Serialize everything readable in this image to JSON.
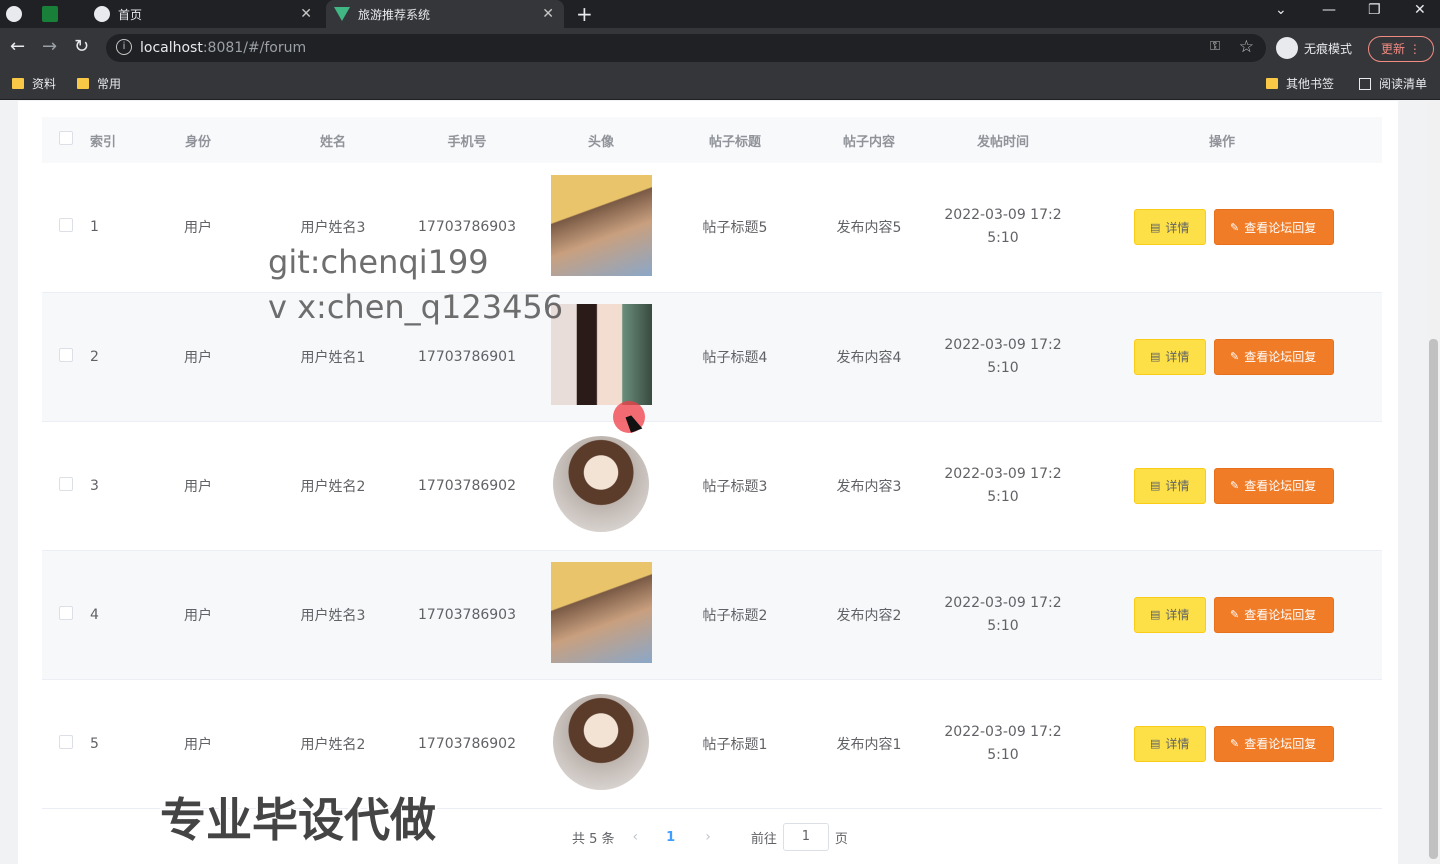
{
  "browser": {
    "tabs": [
      {
        "title": ""
      },
      {
        "title": ""
      },
      {
        "title": "首页"
      },
      {
        "title": "旅游推荐系统"
      }
    ],
    "url_host": "localhost",
    "url_rest": ":8081/#/forum",
    "incognito_label": "无痕模式",
    "update_label": "更新",
    "bookmarks": [
      "资料",
      "常用"
    ],
    "bookmarks_right": [
      "其他书签",
      "阅读清单"
    ]
  },
  "table": {
    "headers": [
      "索引",
      "身份",
      "姓名",
      "手机号",
      "头像",
      "帖子标题",
      "帖子内容",
      "发帖时间",
      "操作"
    ],
    "rows": [
      {
        "index": "1",
        "role": "用户",
        "name": "用户姓名3",
        "phone": "17703786903",
        "title": "帖子标题5",
        "content": "发布内容5",
        "time1": "2022-03-09 17:2",
        "time2": "5:10"
      },
      {
        "index": "2",
        "role": "用户",
        "name": "用户姓名1",
        "phone": "17703786901",
        "title": "帖子标题4",
        "content": "发布内容4",
        "time1": "2022-03-09 17:2",
        "time2": "5:10"
      },
      {
        "index": "3",
        "role": "用户",
        "name": "用户姓名2",
        "phone": "17703786902",
        "title": "帖子标题3",
        "content": "发布内容3",
        "time1": "2022-03-09 17:2",
        "time2": "5:10"
      },
      {
        "index": "4",
        "role": "用户",
        "name": "用户姓名3",
        "phone": "17703786903",
        "title": "帖子标题2",
        "content": "发布内容2",
        "time1": "2022-03-09 17:2",
        "time2": "5:10"
      },
      {
        "index": "5",
        "role": "用户",
        "name": "用户姓名2",
        "phone": "17703786902",
        "title": "帖子标题1",
        "content": "发布内容1",
        "time1": "2022-03-09 17:2",
        "time2": "5:10"
      }
    ],
    "detail_label": "详情",
    "reply_label": "查看论坛回复"
  },
  "pagination": {
    "total": "共 5 条",
    "current": "1",
    "goto_prefix": "前往",
    "goto_value": "1",
    "goto_suffix": "页"
  },
  "overlay": {
    "line1": "git:chenqi199",
    "line2": "v x:chen_q123456",
    "banner": "专业毕设代做"
  }
}
